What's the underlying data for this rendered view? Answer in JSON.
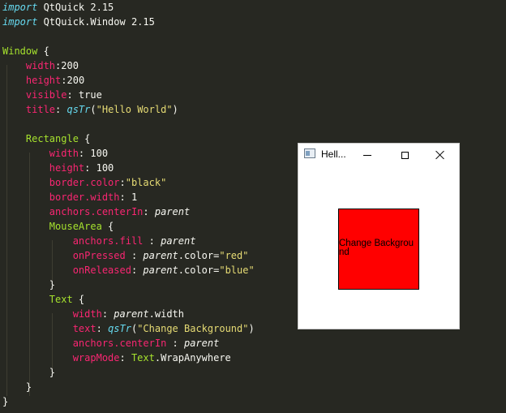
{
  "colors": {
    "editor_bg": "#272822",
    "keyword": "#66d9ef",
    "type": "#a6e22e",
    "property": "#f92672",
    "string": "#e6db74",
    "text": "#f8f8f2",
    "rect_fill": "#ff0000"
  },
  "code": {
    "l1": {
      "kw": "import",
      "rest": " QtQuick 2.15"
    },
    "l2": {
      "kw": "import",
      "rest": " QtQuick.Window 2.15"
    },
    "l4": {
      "type": "Window",
      "rest": " {"
    },
    "l5": {
      "prop": "width",
      "rest": ":200"
    },
    "l6": {
      "prop": "height",
      "rest": ":200"
    },
    "l7": {
      "prop": "visible",
      "rest": ": true"
    },
    "l8": {
      "prop": "title",
      "sep": ": ",
      "fn": "qsTr",
      "open": "(",
      "str": "\"Hello World\"",
      "close": ")"
    },
    "l10": {
      "type": "Rectangle",
      "rest": " {"
    },
    "l11": {
      "prop": "width",
      "rest": ": 100"
    },
    "l12": {
      "prop": "height",
      "rest": ": 100"
    },
    "l13": {
      "prop": "border.color",
      "sep": ":",
      "str": "\"black\""
    },
    "l14": {
      "prop": "border.width",
      "rest": ": 1"
    },
    "l15": {
      "prop": "anchors.centerIn",
      "sep": ": ",
      "it": "parent"
    },
    "l16": {
      "type": "MouseArea",
      "rest": " {"
    },
    "l17": {
      "prop": "anchors.fill",
      "sep": " : ",
      "it": "parent"
    },
    "l18": {
      "prop": "onPressed",
      "sep": " : ",
      "it": "parent",
      "mid": ".color=",
      "str": "\"red\""
    },
    "l19": {
      "prop": "onReleased",
      "sep": ": ",
      "it": "parent",
      "mid": ".color=",
      "str": "\"blue\""
    },
    "l20": {
      "rest": "}"
    },
    "l21": {
      "type": "Text",
      "rest": " {"
    },
    "l22": {
      "prop": "width",
      "sep": ": ",
      "it": "parent",
      "mid": ".width"
    },
    "l23": {
      "prop": "text",
      "sep": ": ",
      "fn": "qsTr",
      "open": "(",
      "str": "\"Change Background\"",
      "close": ")"
    },
    "l24": {
      "prop": "anchors.centerIn",
      "sep": " : ",
      "it": "parent"
    },
    "l25": {
      "prop": "wrapMode",
      "sep": ": ",
      "type": "Text",
      "mid": ".WrapAnywhere"
    },
    "l26": {
      "rest": "}"
    },
    "l27": {
      "rest": "}"
    },
    "l28": {
      "rest": "}"
    }
  },
  "qt_window": {
    "title": "Hell...",
    "app_icon": "window-icon",
    "rect_text": "Change Background"
  }
}
